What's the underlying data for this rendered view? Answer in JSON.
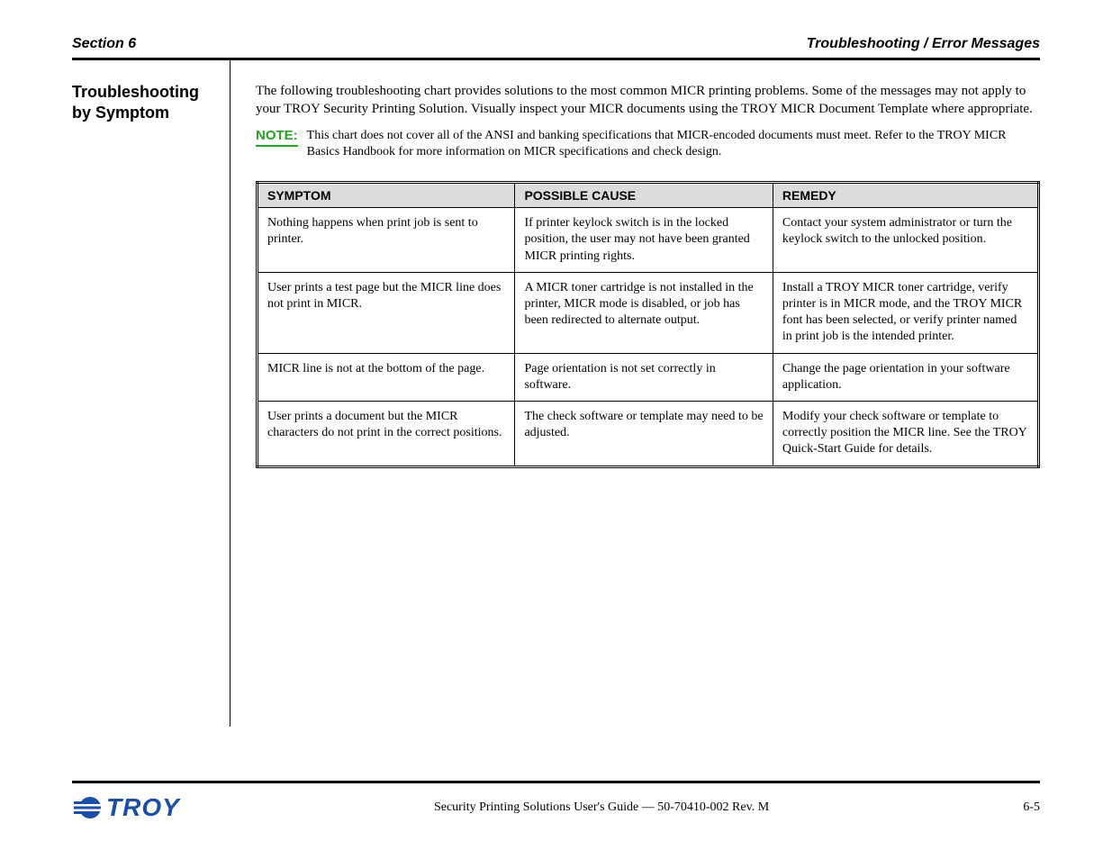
{
  "header": {
    "left": "Section 6",
    "right": "Troubleshooting / Error Messages"
  },
  "sidebar": {
    "heading": "Troubleshooting by Symptom"
  },
  "main": {
    "lead": "The following troubleshooting chart provides solutions to the most common MICR printing problems. Some of the messages may not apply to your TROY Security Printing Solution. Visually inspect your MICR documents using the TROY MICR Document Template where appropriate.",
    "note_label": "NOTE:",
    "note_text": "This chart does not cover all of the ANSI and banking specifications that MICR-encoded documents must meet. Refer to the TROY MICR Basics Handbook for more information on MICR specifications and check design."
  },
  "table": {
    "headers": [
      "SYMPTOM",
      "POSSIBLE CAUSE",
      "REMEDY"
    ],
    "rows": [
      {
        "symptom": "Nothing happens when print job is sent to printer.",
        "cause": "If printer keylock switch is in the locked position, the user may not have been granted MICR printing rights.",
        "remedy": "Contact your system administrator or turn the keylock switch to the unlocked position."
      },
      {
        "symptom": "User prints a test page but the MICR line does not print in MICR.",
        "cause": "A MICR toner cartridge is not installed in the printer, MICR mode is disabled, or job has been redirected to alternate output.",
        "remedy": "Install a TROY MICR toner cartridge, verify printer is in MICR mode, and the TROY MICR font has been selected, or verify printer named in print job is the intended printer."
      },
      {
        "symptom": "MICR line is not at the bottom of the page.",
        "cause": "Page orientation is not set correctly in software.",
        "remedy": "Change the page orientation in your software application."
      },
      {
        "symptom": "User prints a document but the MICR characters do not print in the correct positions.",
        "cause": "The check software or template may need to be adjusted.",
        "remedy": "Modify your check software or template to correctly position the MICR line. See the TROY Quick-Start Guide for details."
      }
    ]
  },
  "footer": {
    "logo_text": "TROY",
    "center": "Security Printing Solutions User's Guide — 50-70410-002 Rev. M",
    "right": "6-5"
  }
}
